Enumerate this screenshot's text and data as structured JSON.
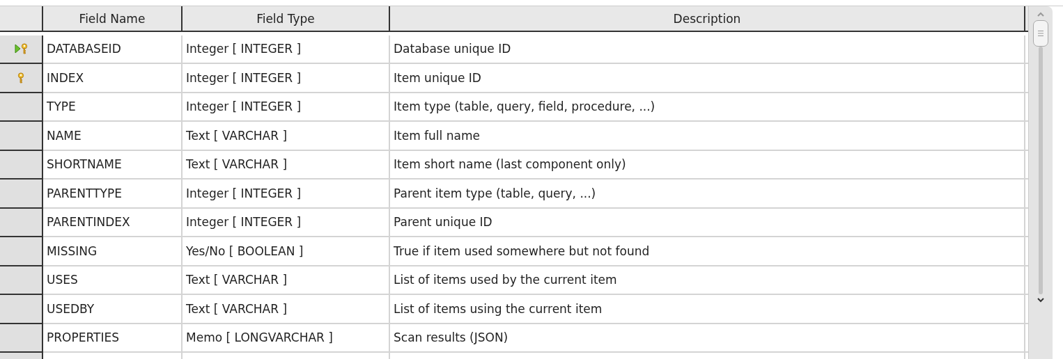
{
  "table": {
    "columns": [
      "Field Name",
      "Field Type",
      "Description"
    ],
    "rows": [
      {
        "current": true,
        "primary_key": true,
        "cells": [
          "DATABASEID",
          "Integer [ INTEGER ]",
          "Database unique ID"
        ]
      },
      {
        "current": false,
        "primary_key": true,
        "cells": [
          "INDEX",
          "Integer [ INTEGER ]",
          "Item unique ID"
        ]
      },
      {
        "current": false,
        "primary_key": false,
        "cells": [
          "TYPE",
          "Integer [ INTEGER ]",
          "Item type (table, query, field, procedure, ...)"
        ]
      },
      {
        "current": false,
        "primary_key": false,
        "cells": [
          "NAME",
          "Text [ VARCHAR ]",
          "Item full name"
        ]
      },
      {
        "current": false,
        "primary_key": false,
        "cells": [
          "SHORTNAME",
          "Text [ VARCHAR ]",
          "Item short name (last component only)"
        ]
      },
      {
        "current": false,
        "primary_key": false,
        "cells": [
          "PARENTTYPE",
          "Integer [ INTEGER ]",
          "Parent item type (table, query, ...)"
        ]
      },
      {
        "current": false,
        "primary_key": false,
        "cells": [
          "PARENTINDEX",
          "Integer [ INTEGER ]",
          "Parent unique ID"
        ]
      },
      {
        "current": false,
        "primary_key": false,
        "cells": [
          "MISSING",
          "Yes/No [ BOOLEAN ]",
          "True if item used somewhere but not found"
        ]
      },
      {
        "current": false,
        "primary_key": false,
        "cells": [
          "USES",
          "Text [ VARCHAR ]",
          "List of items used by the current item"
        ]
      },
      {
        "current": false,
        "primary_key": false,
        "cells": [
          "USEDBY",
          "Text [ VARCHAR ]",
          "List of items using the current item"
        ]
      },
      {
        "current": false,
        "primary_key": false,
        "cells": [
          "PROPERTIES",
          "Memo [ LONGVARCHAR ]",
          "Scan results (JSON)"
        ]
      }
    ]
  }
}
